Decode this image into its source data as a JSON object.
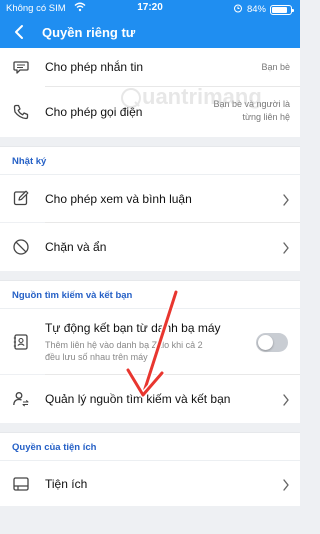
{
  "status_bar": {
    "carrier": "Không có SIM",
    "time": "17:20",
    "battery": "84%",
    "battery_level": 0.84
  },
  "header": {
    "title": "Quyền riêng tư"
  },
  "rows_top": [
    {
      "icon": "chat-icon",
      "label": "Cho phép nhắn tin",
      "value": "Bạn bè"
    },
    {
      "icon": "phone-icon",
      "label": "Cho phép gọi điện",
      "value_line1": "Bạn bè và người là",
      "value_line2": "từng liên hệ"
    }
  ],
  "watermark": {
    "text": "uantrimang"
  },
  "sections": {
    "diary": {
      "title": "Nhật ký",
      "rows": [
        {
          "icon": "edit-icon",
          "label": "Cho phép xem và bình luận"
        },
        {
          "icon": "block-icon",
          "label": "Chặn và ẩn"
        }
      ]
    },
    "sources": {
      "title": "Nguồn tìm kiếm và kết bạn",
      "auto_friend": {
        "label": "Tự động kết bạn từ danh bạ máy",
        "sub_line1": "Thêm liên hệ vào danh bạ Zalo khi cả 2",
        "sub_line2": "đều lưu số nhau trên máy",
        "enabled": false
      },
      "manage": {
        "label": "Quản lý nguồn tìm kiếm và kết bạn"
      }
    },
    "utilities": {
      "title": "Quyền của tiện ích",
      "rows": [
        {
          "icon": "widget-icon",
          "label": "Tiện ích"
        }
      ]
    }
  },
  "colors": {
    "header": "#1f8ef1",
    "section_title": "#2560c6",
    "annotation_arrow": "#e8362f"
  }
}
